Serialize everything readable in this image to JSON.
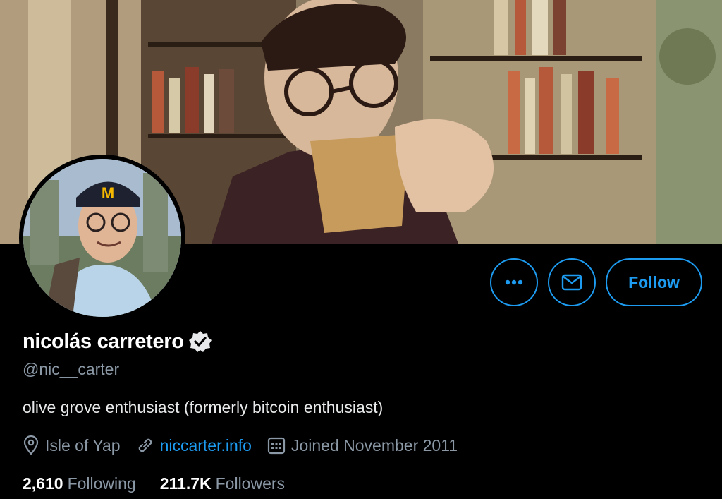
{
  "banner": {
    "icon": "banner-illustration"
  },
  "avatar": {
    "icon": "profile-photo"
  },
  "actions": {
    "more_icon": "ellipsis-icon",
    "message_icon": "envelope-icon",
    "follow_label": "Follow",
    "accent_color": "#1d9bf0"
  },
  "profile": {
    "display_name": "nicolás carretero",
    "verified": true,
    "handle": "@nic__carter",
    "bio": "olive grove enthusiast (formerly bitcoin enthusiast)",
    "location": "Isle of Yap",
    "website": "niccarter.info",
    "joined": "Joined November 2011"
  },
  "stats": {
    "following_count": "2,610",
    "following_label": "Following",
    "followers_count": "211.7K",
    "followers_label": "Followers"
  }
}
